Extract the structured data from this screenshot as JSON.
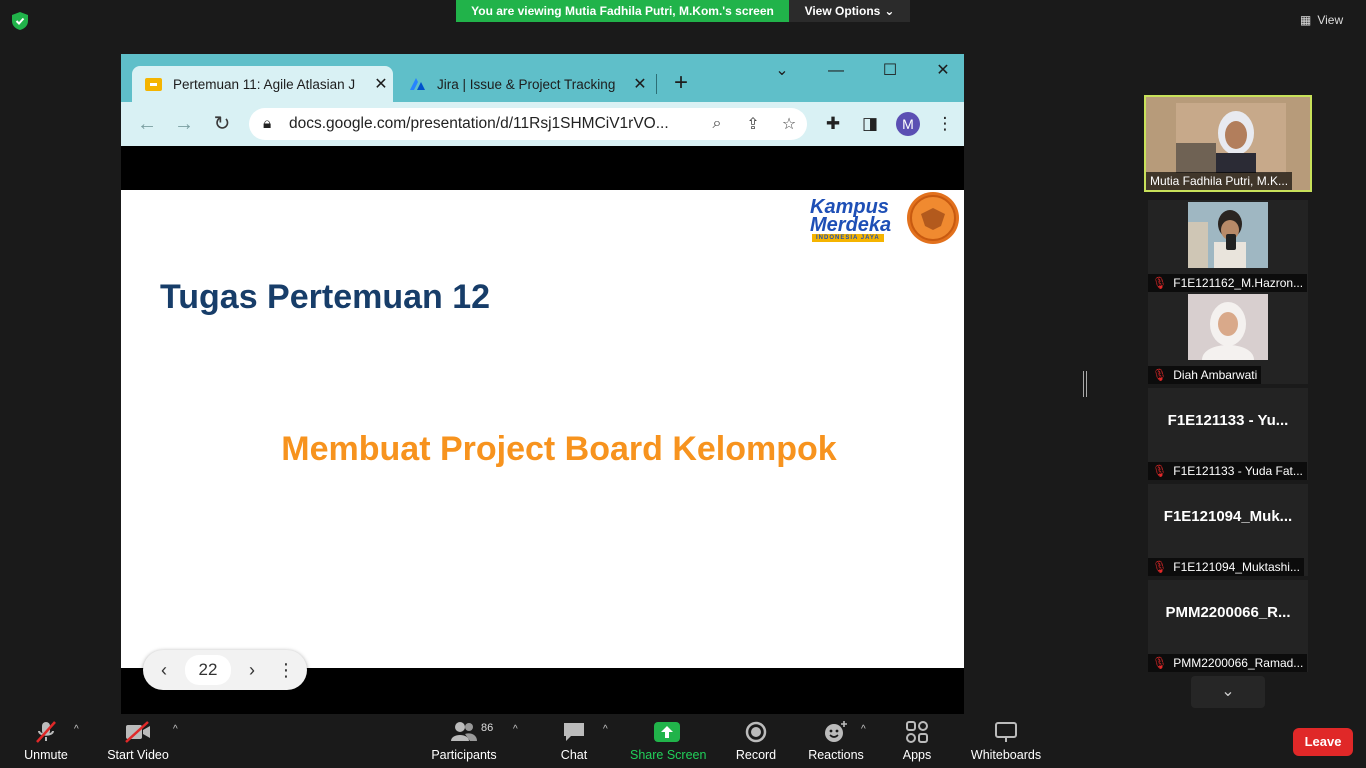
{
  "banner": {
    "text": "You are viewing Mutia Fadhila Putri, M.Kom.'s screen",
    "view_options": "View Options",
    "view": "View"
  },
  "browser": {
    "tabs": [
      {
        "label": "Pertemuan 11: Agile Atlasian J",
        "favicon": "google-slides-icon"
      },
      {
        "label": "Jira | Issue & Project Tracking",
        "favicon": "jira-icon"
      }
    ],
    "url": "docs.google.com/presentation/d/11Rsj1SHMCiV1rVO...",
    "avatar_letter": "M"
  },
  "slide": {
    "logo_line1": "Kampus",
    "logo_line2": "Merdeka",
    "logo_sub": "INDONESIA JAYA",
    "title": "Tugas Pertemuan 12",
    "body": "Membuat Project Board Kelompok",
    "page_number": "22"
  },
  "participants": [
    {
      "name": "Mutia Fadhila Putri, M.K...",
      "active": true
    },
    {
      "name": "F1E121162_M.Hazron...",
      "muted": true,
      "video": true
    },
    {
      "name": "Diah Ambarwati",
      "muted": true,
      "video": true
    },
    {
      "name": "F1E121133 - Yuda Fat...",
      "big": "F1E121133 - Yu...",
      "muted": true
    },
    {
      "name": "F1E121094_Muktashi...",
      "big": "F1E121094_Muk...",
      "muted": true
    },
    {
      "name": "PMM2200066_Ramad...",
      "big": "PMM2200066_R...",
      "muted": true
    }
  ],
  "toolbar": {
    "unmute": "Unmute",
    "start_video": "Start Video",
    "participants_count": "86",
    "participants": "Participants",
    "chat": "Chat",
    "share_screen": "Share Screen",
    "record": "Record",
    "reactions": "Reactions",
    "apps": "Apps",
    "whiteboards": "Whiteboards",
    "leave": "Leave"
  },
  "colors": {
    "share_green": "#21b34a",
    "leave_red": "#e02828",
    "slide_title": "#173d69",
    "slide_body": "#f7931e",
    "active_border": "#c8e15a"
  }
}
